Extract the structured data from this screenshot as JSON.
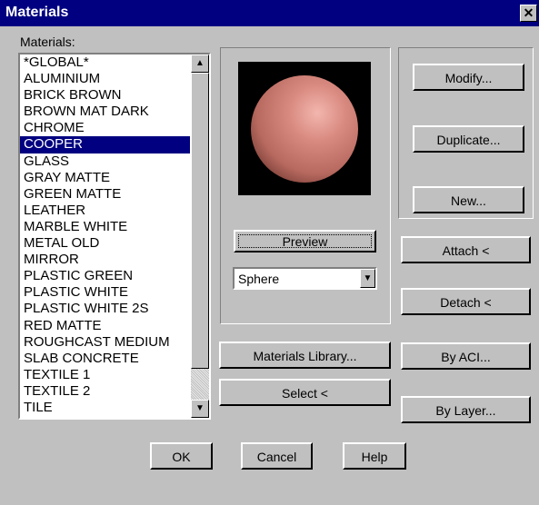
{
  "window": {
    "title": "Materials",
    "close_icon": "close-icon"
  },
  "list_label": "Materials:",
  "materials": [
    "*GLOBAL*",
    "ALUMINIUM",
    "BRICK BROWN",
    "BROWN MAT DARK",
    "CHROME",
    "COOPER",
    "GLASS",
    "GRAY MATTE",
    "GREEN MATTE",
    "LEATHER",
    "MARBLE WHITE",
    "METAL OLD",
    "MIRROR",
    "PLASTIC GREEN",
    "PLASTIC WHITE",
    "PLASTIC WHITE 2S",
    "RED MATTE",
    "ROUGHCAST MEDIUM",
    "SLAB CONCRETE",
    "TEXTILE 1",
    "TEXTILE 2",
    "TILE"
  ],
  "selected_material": "COOPER",
  "preview_button": "Preview",
  "preview_shape": "Sphere",
  "buttons": {
    "modify": "Modify...",
    "duplicate": "Duplicate...",
    "new": "New...",
    "attach": "Attach <",
    "detach": "Detach <",
    "by_aci": "By ACI...",
    "by_layer": "By Layer...",
    "materials_library": "Materials Library...",
    "select": "Select <",
    "ok": "OK",
    "cancel": "Cancel",
    "help": "Help"
  },
  "colors": {
    "title_bar": "#000080",
    "selection": "#000080",
    "dialog_bg": "#c0c0c0",
    "sphere": "#d4827a"
  }
}
